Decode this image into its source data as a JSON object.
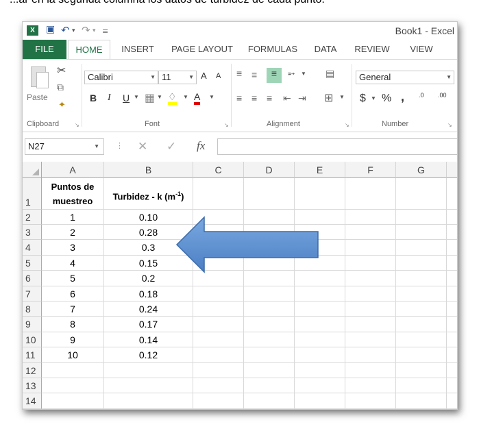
{
  "caption_fragment": "...ar en la segunda columna los datos de turbidez de cada punto.",
  "app": {
    "icon_label": "X",
    "window_title": "Book1 - Excel"
  },
  "quick_access": {
    "save": "💾",
    "undo": "↶",
    "redo": "↷",
    "customize": "="
  },
  "tabs": [
    "FILE",
    "HOME",
    "INSERT",
    "PAGE LAYOUT",
    "FORMULAS",
    "DATA",
    "REVIEW",
    "VIEW"
  ],
  "ribbon": {
    "clipboard": {
      "label": "Clipboard",
      "paste_label": "Paste"
    },
    "font": {
      "label": "Font",
      "name": "Calibri",
      "size": "11",
      "bold": "B",
      "italic": "I",
      "underline": "U",
      "grow": "A",
      "shrink": "A",
      "font_color": "A"
    },
    "alignment": {
      "label": "Alignment"
    },
    "number": {
      "label": "Number",
      "format": "General",
      "currency": "$",
      "percent": "%",
      "comma": ",",
      "inc_decimal": ".00",
      "dec_decimal": ".0"
    }
  },
  "formula_bar": {
    "name_box": "N27",
    "fx": "fx",
    "cancel": "✕",
    "enter": "✓",
    "content": ""
  },
  "columns": [
    "A",
    "B",
    "C",
    "D",
    "E",
    "F",
    "G"
  ],
  "rows": [
    "1",
    "2",
    "3",
    "4",
    "5",
    "6",
    "7",
    "8",
    "9",
    "10",
    "11",
    "12",
    "13",
    "14"
  ],
  "table": {
    "header_a_line1": "Puntos de",
    "header_a_line2": "muestreo",
    "header_b": "Turbidez - k (m",
    "header_b_sup": "-1",
    "header_b_end": ")",
    "data": [
      {
        "punto": "1",
        "turbidez": "0.10"
      },
      {
        "punto": "2",
        "turbidez": "0.28"
      },
      {
        "punto": "3",
        "turbidez": "0.3"
      },
      {
        "punto": "4",
        "turbidez": "0.15"
      },
      {
        "punto": "5",
        "turbidez": "0.2"
      },
      {
        "punto": "6",
        "turbidez": "0.18"
      },
      {
        "punto": "7",
        "turbidez": "0.24"
      },
      {
        "punto": "8",
        "turbidez": "0.17"
      },
      {
        "punto": "9",
        "turbidez": "0.14"
      },
      {
        "punto": "10",
        "turbidez": "0.12"
      }
    ]
  },
  "colors": {
    "excel_green": "#217346",
    "arrow_fill": "#5b8fd0",
    "arrow_stroke": "#3a6aaa"
  }
}
